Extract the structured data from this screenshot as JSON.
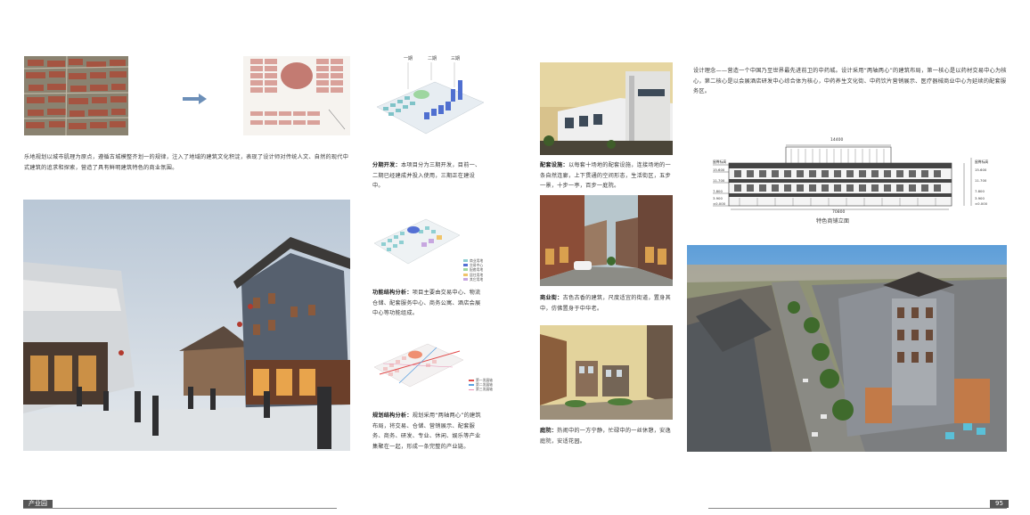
{
  "left_page": {
    "analysis_caption": "乐地规划以城市肌理为原点，遵循古城模整齐划一的规律，注入了地域的建筑文化积淀，表现了设计师对传统人文、自然的现代中式建筑的追求和探索，营造了具有鲜明建筑特色的商业氛围。"
  },
  "middle_column": {
    "diagram1": {
      "labels": [
        "一期",
        "二期",
        "三期"
      ],
      "label_title": "分期开发：",
      "caption": "本项目分为三期开发，目前一、二期已经建成并投入使用，三期正在建设中。"
    },
    "diagram2": {
      "legend": [
        "商业用地",
        "交易中心",
        "配套用地",
        "居住用地",
        "其它用地"
      ],
      "label_title": "功能结构分析：",
      "caption": "项目主要由交易中心、物流仓储、配套服务中心、商务公寓、酒店会展中心等功能组成。"
    },
    "diagram3": {
      "legend": [
        "第一发展轴",
        "第二发展轴",
        "第三发展轴"
      ],
      "label_title": "规划结构分析：",
      "caption": "规划采用“两轴两心”的建筑布局，将交易、仓储、营销展示、配套服务、商务、研发、专业、休闲、娱乐等产业集聚在一起，形成一条完整的产业链。"
    }
  },
  "right_column": {
    "photo1": {
      "label_title": "配套设施：",
      "caption": "以每套十场地的配套设施，连接场地的一条自然连廊，上下贯通的空间形态，生活街区，五步一景，十步一亭，百步一庭院。"
    },
    "photo2": {
      "label_title": "商业街：",
      "caption": "古色古香的建筑，尺度适宜的街道，置身其中，仿佛置身于中华老。"
    },
    "photo3": {
      "label_title": "庭院：",
      "caption": "热闹中的一方宁静，忙碌中的一丝休憩，安逸庭院，安适花园。"
    }
  },
  "right_page": {
    "design_concept": "设计理念——营造一个中国乃至世界最先进前卫的中药城。设计采用“两轴两心”的建筑布局，第一核心是以药材交易中心为核心，第二核心是以会展酒店研发中心综合体为核心，中药养生文化街、中药饮片营销展示、医疗器械商业中心为延续的配套服务区。",
    "elevation_caption": "特色商铺立面",
    "elevation_dims": {
      "width": "14400",
      "total": "70800"
    },
    "elevation_levels": [
      "屋脊标高",
      "15.600",
      "11.700",
      "7.800",
      "3.900",
      "±0.000"
    ]
  },
  "footer": {
    "left_tab": "产业园",
    "page_number": "95"
  }
}
